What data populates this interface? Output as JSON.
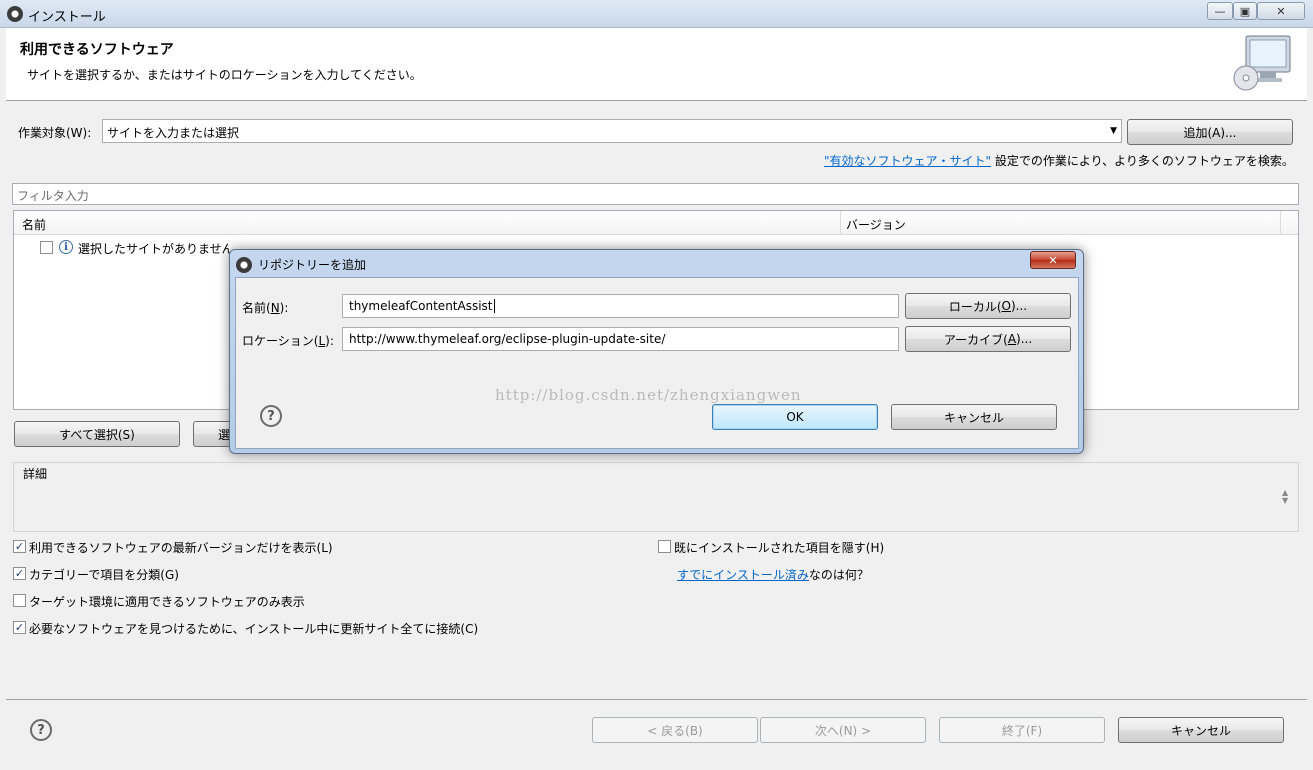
{
  "window": {
    "title": "インストール"
  },
  "header": {
    "title": "利用できるソフトウェア",
    "description": "サイトを選択するか、またはサイトのロケーションを入力してください。"
  },
  "work_with": {
    "label": "作業対象(W):",
    "value": "サイトを入力または選択",
    "add_button": "追加(A)...",
    "link_text": "\"有効なソフトウェア・サイト\"",
    "link_suffix": "設定での作業により、より多くのソフトウェアを検索。"
  },
  "filter": {
    "placeholder": "フィルタ入力"
  },
  "tree": {
    "columns": [
      "名前",
      "バージョン"
    ],
    "rows": [
      {
        "label": "選択したサイトがありません。"
      }
    ]
  },
  "selection_buttons": {
    "select_all": "すべて選択(S)",
    "deselect_partial": "選"
  },
  "details": {
    "label": "詳細"
  },
  "options": {
    "latest_only": {
      "label": "利用できるソフトウェアの最新バージョンだけを表示(L)",
      "checked": true
    },
    "group_by_category": {
      "label": "カテゴリーで項目を分類(G)",
      "checked": true
    },
    "target_env_only": {
      "label": "ターゲット環境に適用できるソフトウェアのみ表示",
      "checked": false
    },
    "contact_all_sites": {
      "label": "必要なソフトウェアを見つけるために、インストール中に更新サイト全てに接続(C)",
      "checked": true
    },
    "hide_installed": {
      "label": "既にインストールされた項目を隠す(H)",
      "checked": false
    },
    "installed_link": "すでにインストール済み",
    "installed_suffix": "なのは何？"
  },
  "wizard": {
    "back": "< 戻る(B)",
    "next": "次へ(N) >",
    "finish": "終了(F)",
    "cancel": "キャンセル"
  },
  "dialog": {
    "title": "リポジトリーを追加",
    "name_label_pre": "名前(",
    "name_label_key": "N",
    "name_label_post": "):",
    "name_value": "thymeleafContentAssist",
    "location_label_pre": "ロケーション(",
    "location_label_key": "L",
    "location_label_post": "):",
    "location_value": "http://www.thymeleaf.org/eclipse-plugin-update-site/",
    "local_pre": "ローカル(",
    "local_key": "O",
    "local_post": ")...",
    "archive_pre": "アーカイブ(",
    "archive_key": "A",
    "archive_post": ")...",
    "ok": "OK",
    "cancel": "キャンセル"
  },
  "watermark": "http://blog.csdn.net/zhengxiangwen",
  "colors": {
    "link": "#0066cc",
    "dialog_frame": "#b6cbe6",
    "close_button": "#c4452f"
  }
}
